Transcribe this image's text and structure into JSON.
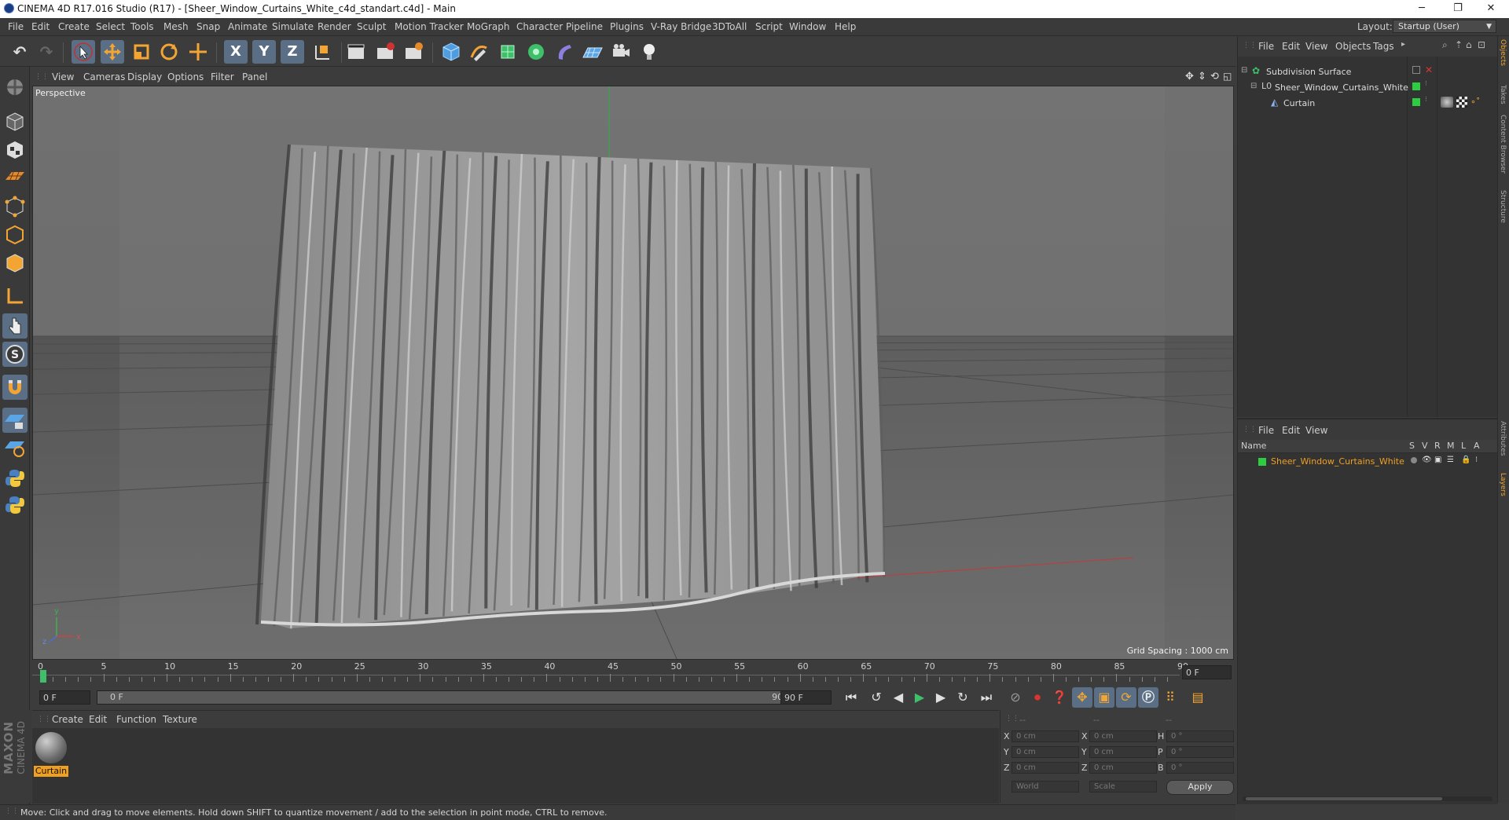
{
  "window": {
    "title": "CINEMA 4D R17.016 Studio (R17) - [Sheer_Window_Curtains_White_c4d_standart.c4d] - Main",
    "min_glyph": "─",
    "restore_glyph": "❐",
    "close_glyph": "✕"
  },
  "menubar": {
    "items": [
      "File",
      "Edit",
      "Create",
      "Select",
      "Tools",
      "Mesh",
      "Snap",
      "Animate",
      "Simulate",
      "Render",
      "Sculpt",
      "Motion Tracker",
      "MoGraph",
      "Character",
      "Pipeline",
      "Plugins",
      "V-Ray Bridge",
      "3DToAll",
      "Script",
      "Window",
      "Help"
    ],
    "layout_label": "Layout:",
    "layout_value": "Startup (User)"
  },
  "toolbar": {
    "x_label": "X",
    "y_label": "Y",
    "z_label": "Z"
  },
  "viewport": {
    "menu": [
      "View",
      "Cameras",
      "Display",
      "Options",
      "Filter",
      "Panel"
    ],
    "camera_label": "Perspective",
    "grid_spacing": "Grid Spacing : 1000 cm",
    "axis_x": "x",
    "axis_y": "y",
    "axis_z": "z"
  },
  "timeline": {
    "ticks": [
      "0",
      "5",
      "10",
      "15",
      "20",
      "25",
      "30",
      "35",
      "40",
      "45",
      "50",
      "55",
      "60",
      "65",
      "70",
      "75",
      "80",
      "85",
      "90"
    ],
    "current_frame": "0 F",
    "start_field": "0 F",
    "range_start": "0 F",
    "range_end": "90 F",
    "end_field": "90 F"
  },
  "material_manager": {
    "menu": [
      "Create",
      "Edit",
      "Function",
      "Texture"
    ],
    "materials": [
      {
        "name": "Curtain"
      }
    ]
  },
  "coordinates": {
    "headers": [
      "--",
      "--",
      "--"
    ],
    "rows": [
      {
        "axis": "X",
        "pos": "0 cm",
        "axis2": "X",
        "size": "0 cm",
        "rot_label": "H",
        "rot": "0 °"
      },
      {
        "axis": "Y",
        "pos": "0 cm",
        "axis2": "Y",
        "size": "0 cm",
        "rot_label": "P",
        "rot": "0 °"
      },
      {
        "axis": "Z",
        "pos": "0 cm",
        "axis2": "Z",
        "size": "0 cm",
        "rot_label": "B",
        "rot": "0 °"
      }
    ],
    "mode_world": "World",
    "mode_scale": "Scale",
    "apply_label": "Apply"
  },
  "object_manager": {
    "menu": [
      "File",
      "Edit",
      "View",
      "Objects",
      "Tags"
    ],
    "objects": [
      {
        "name": "Subdivision Surface",
        "level": 0
      },
      {
        "name": "Sheer_Window_Curtains_White",
        "level": 1
      },
      {
        "name": "Curtain",
        "level": 2
      }
    ]
  },
  "layer_manager": {
    "menu": [
      "File",
      "Edit",
      "View"
    ],
    "columns": [
      "Name",
      "S",
      "V",
      "R",
      "M",
      "L",
      "A"
    ],
    "layers": [
      {
        "name": "Sheer_Window_Curtains_White",
        "color": "#2ecc40"
      }
    ]
  },
  "side_tabs": [
    "Objects",
    "Takes",
    "Content Browser",
    "Structure",
    "Attributes",
    "Layers"
  ],
  "brand": {
    "maxon": "MAXON",
    "product": "CINEMA 4D"
  },
  "status": "Move: Click and drag to move elements. Hold down SHIFT to quantize movement / add to the selection in point mode, CTRL to remove.",
  "colors": {
    "accent": "#5a6f86",
    "layer_green": "#2ecc40",
    "selected_orange": "#f0a020"
  }
}
